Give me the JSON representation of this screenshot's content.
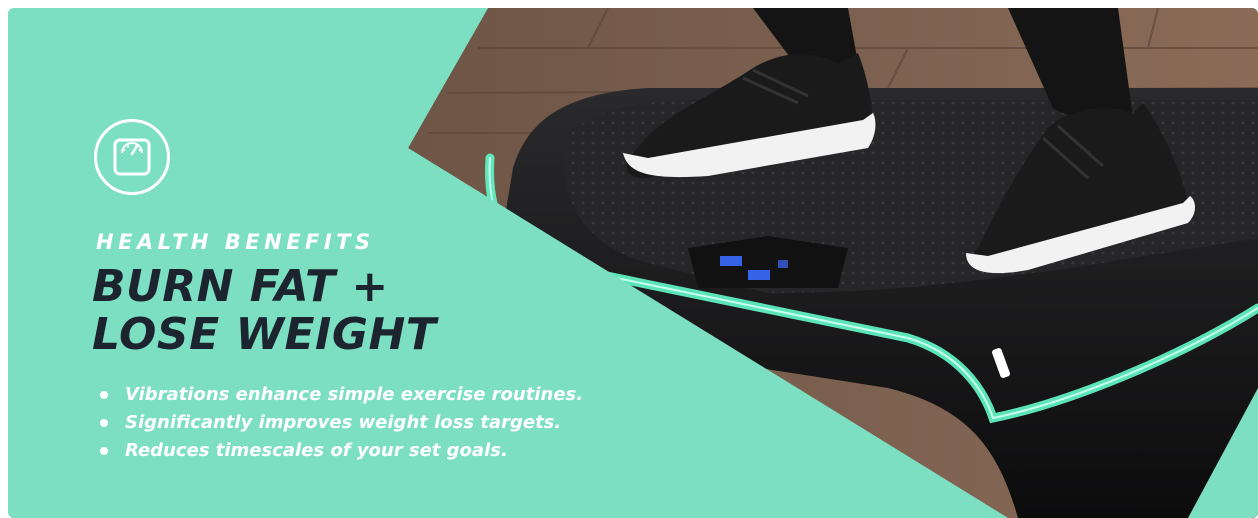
{
  "banner": {
    "eyebrow": "HEALTH BENEFITS",
    "headline_line1": "BURN FAT +",
    "headline_line2": "LOSE WEIGHT",
    "benefits": [
      "Vibrations enhance simple exercise routines.",
      "Significantly improves weight loss targets.",
      "Reduces timescales of your set goals."
    ],
    "badge_icon": "bathroom-scale-icon",
    "colors": {
      "background": "#7ddfc2",
      "headline": "#1c2430",
      "text": "#ffffff",
      "glow": "#5ff0c0"
    }
  }
}
